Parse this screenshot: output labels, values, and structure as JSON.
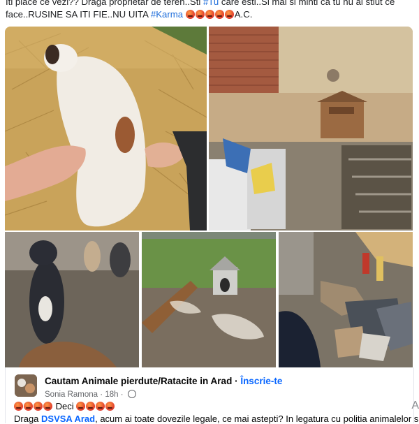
{
  "post": {
    "line1": "Iti place ce vezi?? Draga proprietar de teren..Sti ",
    "tag_tu": "#Tu",
    "line1_rest": " care esti..Si mai si minti ca tu nu ai stiut ce",
    "line2": "face..RUSINE SA ITI FIE..NU UITA ",
    "tag_karma": "#Karma",
    "line2_end": "A.C."
  },
  "gallery": {
    "tiles": [
      {
        "name": "puppy-on-hay-photo",
        "desc": "white puppy on hay"
      },
      {
        "name": "dog-shelter-yard-photo",
        "desc": "dirty yard with doghouse"
      },
      {
        "name": "dogs-in-mud-photo",
        "desc": "dogs in mud"
      },
      {
        "name": "doghouse-field-photo",
        "desc": "doghouse in field"
      },
      {
        "name": "trash-pile-photo",
        "desc": "trash pile"
      }
    ]
  },
  "shared_post": {
    "group_name": "Cautam Animale pierdute/Ratacite in Arad",
    "separator": " · ",
    "join_label": "Înscrie-te",
    "author": "Sonia Ramona",
    "time": "18h",
    "dot": " · ",
    "body_word": "Deci",
    "line2_start": "Draga ",
    "mention": "DSVSA Arad",
    "line2_rest": ", acum ai toate dovezile legale, ce mai astepti? In legatura cu politia animalelor si"
  },
  "side_glyph": "A"
}
